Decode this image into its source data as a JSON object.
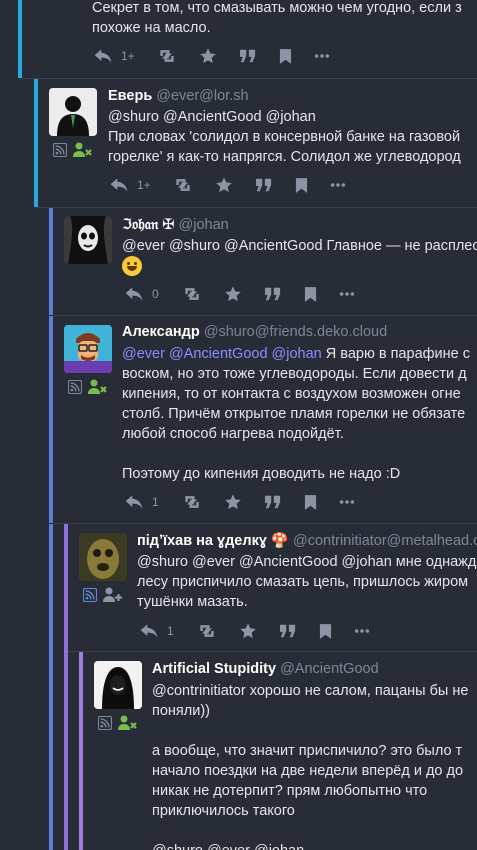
{
  "posts": [
    {
      "name": "",
      "acct": "",
      "lines": [
        "Секрет в том, что смазывать можно чем угодно, если з",
        "похоже на масло."
      ],
      "replies": "1+",
      "bar_color": "#29a8e0"
    },
    {
      "name": "Еверь",
      "acct": "@ever@lor.sh",
      "mentions": "@shuro @AncientGood @johan",
      "lines": [
        "При словах 'солидол в консервной банке на газовой",
        "горелке' я как-то напрягся. Солидол же углеводород"
      ],
      "replies": "1+",
      "bar_color": "#29a8e0"
    },
    {
      "name": "ℑ𝔬𝔥𝔞𝔫",
      "name_symbol": "✠",
      "acct": "@johan",
      "mentions": "@ever @shuro @AncientGood",
      "text": " Главное — не расплес",
      "replies": "0",
      "bar_color": "#5a7fd8"
    },
    {
      "name": "Александр",
      "acct": "@shuro@friends.deko.cloud",
      "mentions": "@ever @AncientGood @johan",
      "text": " Я варю в парафине с",
      "lines": [
        "воском, но это тоже углеводороды. Если довести д",
        "кипения, то от контакта с воздухом возможен огне",
        "столб. Причём открытое пламя горелки не обязате",
        "любой способ нагрева подойдёт.",
        "",
        "Поэтому до кипения доводить не надо :D"
      ],
      "replies": "1",
      "bar_color": "#5a7fd8"
    },
    {
      "name": "підʼїхав на ɣделкɣ",
      "acct": "@contrinitiator@metalhead.cl",
      "mentions": "@shuro @ever @AncientGood @johan",
      "text": " мне однажд",
      "lines": [
        "лесу приспичило смазать цепь, пришлось жиром",
        "тушёнки мазать."
      ],
      "replies": "1",
      "bar_color": "#8f6fd8"
    },
    {
      "name": "Artificial Stupidity",
      "acct": "@AncientGood",
      "mentions": "@contrinitiator",
      "text": " хорошо не салом, пацаны бы не",
      "lines": [
        "поняли))",
        "",
        "а вообще, что значит приспичило? это было т",
        "начало поездки на две недели вперёд и до до",
        "никак не дотерпит? прям любопытно что",
        "приключилось такого",
        "",
        "@shuro @ever @johan"
      ],
      "bar_color": "#a07be0"
    }
  ],
  "icons": {
    "reply": "reply-icon",
    "boost": "boost-icon",
    "favourite": "star-icon",
    "quote": "quote-icon",
    "bookmark": "bookmark-icon",
    "more": "more-icon",
    "rss": "rss-icon",
    "follow": "follow-icon"
  },
  "colors": {
    "background": "#282c37",
    "mention": "#8c8dff",
    "follow_green": "#79bd4a"
  }
}
